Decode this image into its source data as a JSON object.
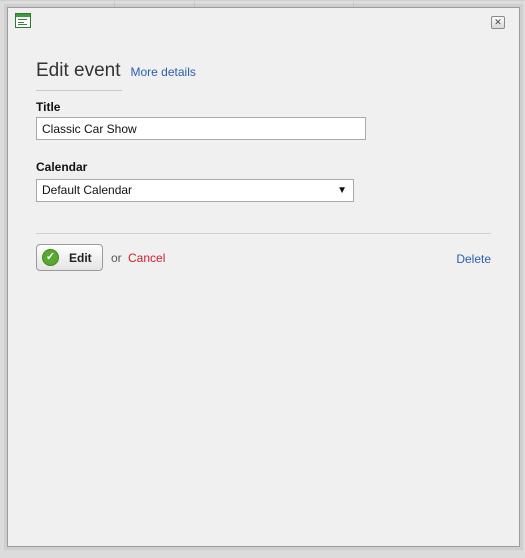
{
  "dialog": {
    "heading": "Edit event",
    "more_details": "More details",
    "title_label": "Title",
    "title_value": "Classic Car Show",
    "calendar_label": "Calendar",
    "calendar_value": "Default Calendar",
    "edit_button": "Edit",
    "or_text": "or",
    "cancel": "Cancel",
    "delete": "Delete",
    "close_symbol": "✕"
  },
  "colors": {
    "link_blue": "#2a5db0",
    "cancel_red": "#d0202a",
    "confirm_green": "#58a832"
  },
  "icons": [
    "calendar-app-icon",
    "close-icon",
    "checkmark-icon",
    "dropdown-arrow-icon"
  ]
}
